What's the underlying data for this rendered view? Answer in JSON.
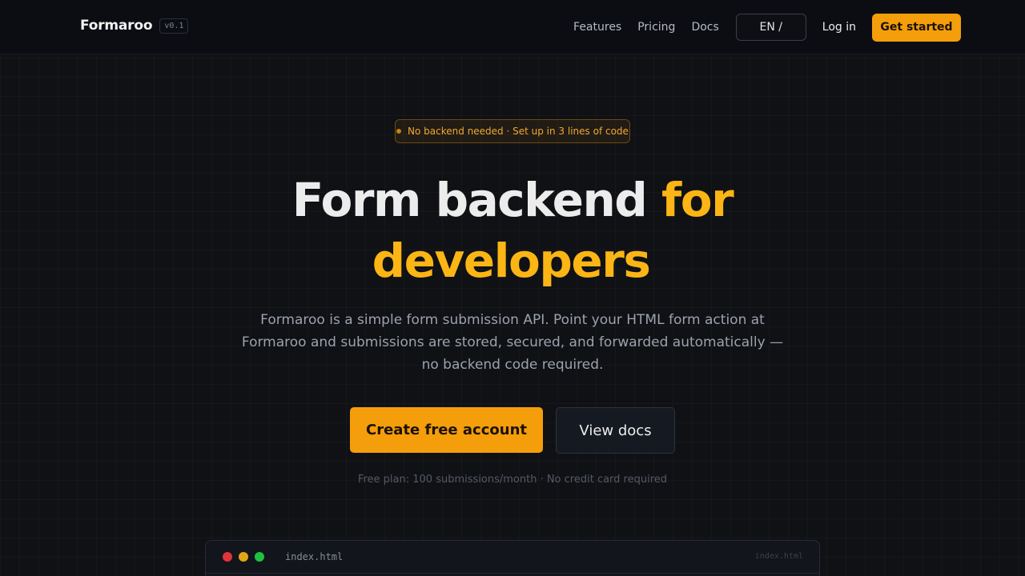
{
  "header": {
    "brand": "Formaroo",
    "version": "v0.1",
    "nav": [
      {
        "label": "Features"
      },
      {
        "label": "Pricing"
      },
      {
        "label": "Docs"
      }
    ],
    "language": "EN /",
    "login": "Log in",
    "get_started": "Get started"
  },
  "hero": {
    "badge": "No backend needed · Set up in 3 lines of code",
    "title_part1": "Form backend ",
    "title_accent1": "for",
    "title_accent2": "developers",
    "subtitle": "Formaroo is a simple form submission API. Point your HTML form action at Formaroo and submissions are stored, secured, and forwarded automatically — no backend code required.",
    "primary_cta": "Create free account",
    "secondary_cta": "View docs",
    "plan_note": "Free plan: 100 submissions/month · No credit card required"
  },
  "code_window": {
    "file_name": "index.html",
    "file_name_right": "index.html"
  },
  "colors": {
    "accent": "#f59e0b",
    "background": "#0f1115"
  }
}
